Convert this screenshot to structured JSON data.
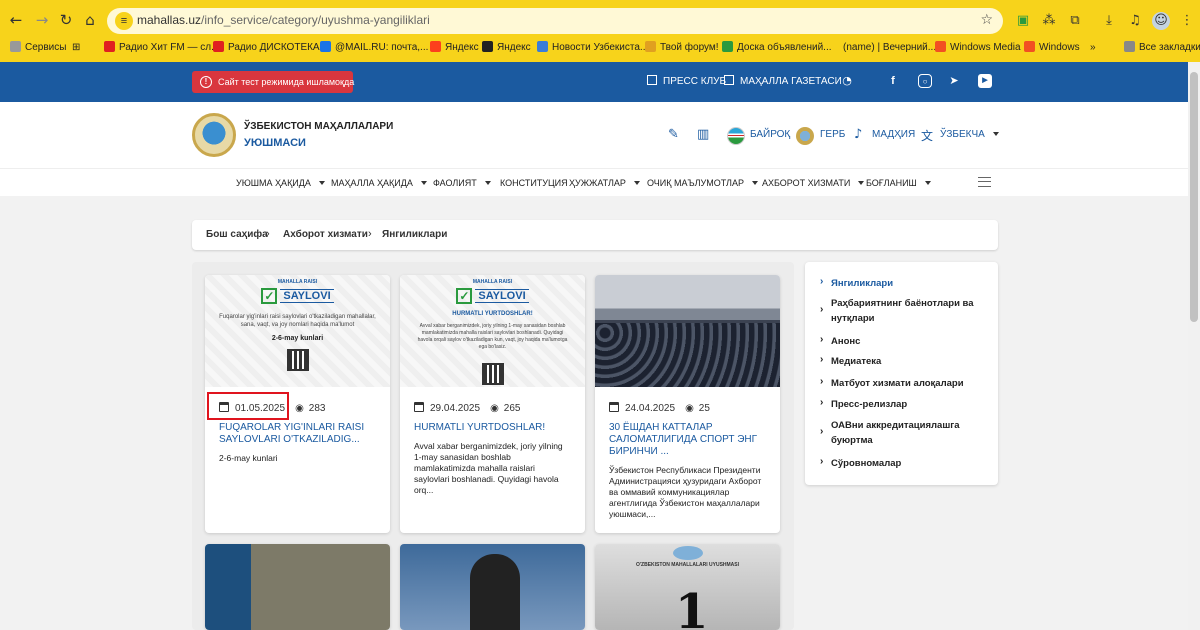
{
  "browser": {
    "url_host": "mahallas.uz",
    "url_path": "/info_service/category/uyushma-yangiliklari",
    "bookmarks": [
      {
        "label": "Сервисы",
        "color": "#999999"
      },
      {
        "label": "⊞",
        "color": "transparent"
      },
      {
        "label": "Радио Хит FM — сл...",
        "color": "#e02020"
      },
      {
        "label": "Радио ДИСКОТЕКА...",
        "color": "#e02020"
      },
      {
        "label": "@MAIL.RU: почта,...",
        "color": "#1a73e8"
      },
      {
        "label": "Яндекс",
        "color": "#fc3f1d"
      },
      {
        "label": "Яндекс",
        "color": "#222222"
      },
      {
        "label": "Новости Узбекиста...",
        "color": "#3b7dd8"
      },
      {
        "label": "Твой форум!",
        "color": "#e0a020"
      },
      {
        "label": "Доска объявлений...",
        "color": "#2a9a3e"
      },
      {
        "label": "(name) | Вечерний...",
        "color": "transparent"
      },
      {
        "label": "Windows Media",
        "color": "#f25022"
      },
      {
        "label": "Windows",
        "color": "#f25022"
      },
      {
        "label": "»",
        "color": "transparent"
      },
      {
        "label": "Все закладки",
        "color": "#888888"
      }
    ]
  },
  "topbar": {
    "alert": "Сайт тест режимида ишламоқда",
    "press_club": "ПРЕСС КЛУБ",
    "newspaper": "МАҲАЛЛА ГАЗЕТАСИ"
  },
  "header": {
    "brand_line1": "ЎЗБЕКИСТОН МАҲАЛЛАЛАРИ",
    "brand_line2": "УЮШМАСИ",
    "flag": "БАЙРОҚ",
    "emblem": "ГЕРБ",
    "anthem": "МАДҲИЯ",
    "language": "ЎЗБЕКЧА"
  },
  "nav": [
    "УЮШМА ҲАҚИДА",
    "МАҲАЛЛА ҲАҚИДА",
    "ФАОЛИЯТ",
    "КОНСТИТУЦИЯ",
    "ҲУЖЖАТЛАР",
    "ОЧИҚ МАЪЛУМОТЛАР",
    "АХБОРОТ ХИЗМАТИ",
    "БОҒЛАНИШ"
  ],
  "breadcrumb": [
    "Бош саҳифа",
    "Ахборот хизмати",
    "Янгиликлари"
  ],
  "cards": [
    {
      "poster_title": "SAYLOVI",
      "poster_brand": "MAHALLA RAISI",
      "poster_text": "Fuqarolar yig'inlari raisi saylovlari o'tkaziladigan mahallalar, sana, vaqt, va joy nomlari haqida ma'lumot",
      "poster_date": "2-6-may kunlari",
      "date": "01.05.2025",
      "views": "283",
      "title": "FUQAROLAR YIG'INLARI RAISI SAYLOVLARI O'TKAZILADIG...",
      "excerpt": "2-6-may kunlari"
    },
    {
      "poster_title": "SAYLOVI",
      "poster_brand": "MAHALLA RAISI",
      "poster_heading": "HURMATLI YURTDOSHLAR!",
      "poster_text": "Avval xabar berganimizdek, joriy yilning 1-may sanasidan boshlab mamlakatimizda mahalla raislari saylovlari boshlanadi. Quyidagi havola orqali saylov o'tkaziladigan kun, vaqt, joy haqida ma'lumotga ega bo'lasiz.",
      "date": "29.04.2025",
      "views": "265",
      "title": "HURMATLI YURTDOSHLAR!",
      "excerpt": "Avval xabar berganimizdek, joriy yilning 1-may sanasidan boshlab mamlakatimizda mahalla raislari saylovlari boshlanadi. Quyidagi havola orq..."
    },
    {
      "date": "24.04.2025",
      "views": "25",
      "title": "30 ЁШДАН КАТТАЛАР САЛОМАТЛИГИДА СПОРТ ЭНГ БИРИНЧИ ...",
      "excerpt": "Ўзбекистон Республикаси Президенти Администрацияси ҳузуридаги Ахборот ва оммавий коммуникациялар агентлигида Ўзбекистон маҳаллалари уюшмаси,..."
    }
  ],
  "bottom_cards": {
    "third_label": "O'ZBEKISTON MAHALLALARI UYUSHMASI",
    "third_number": "1"
  },
  "sidebar": [
    "Янгиликлари",
    "Раҳбариятнинг баёнотлари ва нутқлари",
    "Анонс",
    "Медиатека",
    "Матбуот хизмати алоқалари",
    "Пресс-релизлар",
    "ОАВни аккредитациялашга буюртма",
    "Сўровномалар"
  ],
  "colors": {
    "brand_blue": "#1b5aa0",
    "alert_red": "#d9363e",
    "browser_yellow": "#f7d31b",
    "highlight_red": "#e0141e"
  },
  "icons": {
    "back": "arrow-left-icon",
    "forward": "arrow-right-icon",
    "reload": "reload-icon",
    "home": "home-icon",
    "star": "star-icon",
    "calendar": "calendar-icon",
    "views": "eye-icon"
  }
}
